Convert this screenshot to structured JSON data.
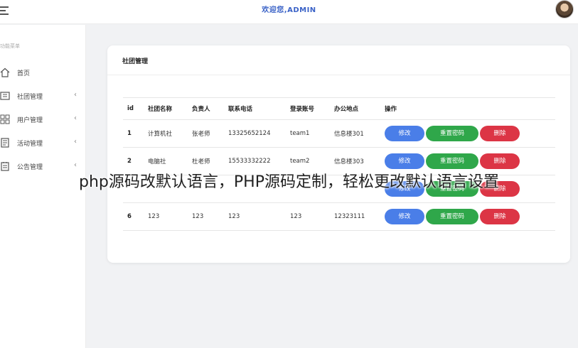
{
  "header": {
    "welcome": "欢迎您,ADMIN"
  },
  "sidebar": {
    "heading": "功能菜单",
    "items": [
      {
        "label": "首页",
        "icon": "home-icon",
        "has_submenu": false
      },
      {
        "label": "社团管理",
        "icon": "club-icon",
        "has_submenu": true
      },
      {
        "label": "用户管理",
        "icon": "grid-icon",
        "has_submenu": true
      },
      {
        "label": "活动管理",
        "icon": "document-icon",
        "has_submenu": true
      },
      {
        "label": "公告管理",
        "icon": "notice-icon",
        "has_submenu": true
      }
    ],
    "chevron": "‹"
  },
  "card": {
    "title": "社团管理"
  },
  "table": {
    "headers": [
      "id",
      "社团名称",
      "负责人",
      "联系电话",
      "登录账号",
      "办公地点",
      "操作"
    ],
    "rows": [
      {
        "id": "1",
        "name": "计算机社",
        "leader": "张老师",
        "phone": "13325652124",
        "account": "team1",
        "office": "信息楼301"
      },
      {
        "id": "2",
        "name": "电脑社",
        "leader": "杜老师",
        "phone": "15533332222",
        "account": "team2",
        "office": "信息楼303"
      },
      {
        "id": "",
        "name": "",
        "leader": "",
        "phone": "",
        "account": "",
        "office": ""
      },
      {
        "id": "6",
        "name": "123",
        "leader": "123",
        "phone": "123",
        "account": "123",
        "office": "12323111"
      }
    ],
    "actions": {
      "edit": "修改",
      "reset": "重置密码",
      "delete": "删除"
    }
  },
  "overlay": {
    "caption": "php源码改默认语言，PHP源码定制，轻松更改默认语言设置"
  },
  "colors": {
    "accent": "#3a62c7",
    "edit": "#4a7ee8",
    "reset": "#2fa74a",
    "delete": "#dc3545"
  }
}
